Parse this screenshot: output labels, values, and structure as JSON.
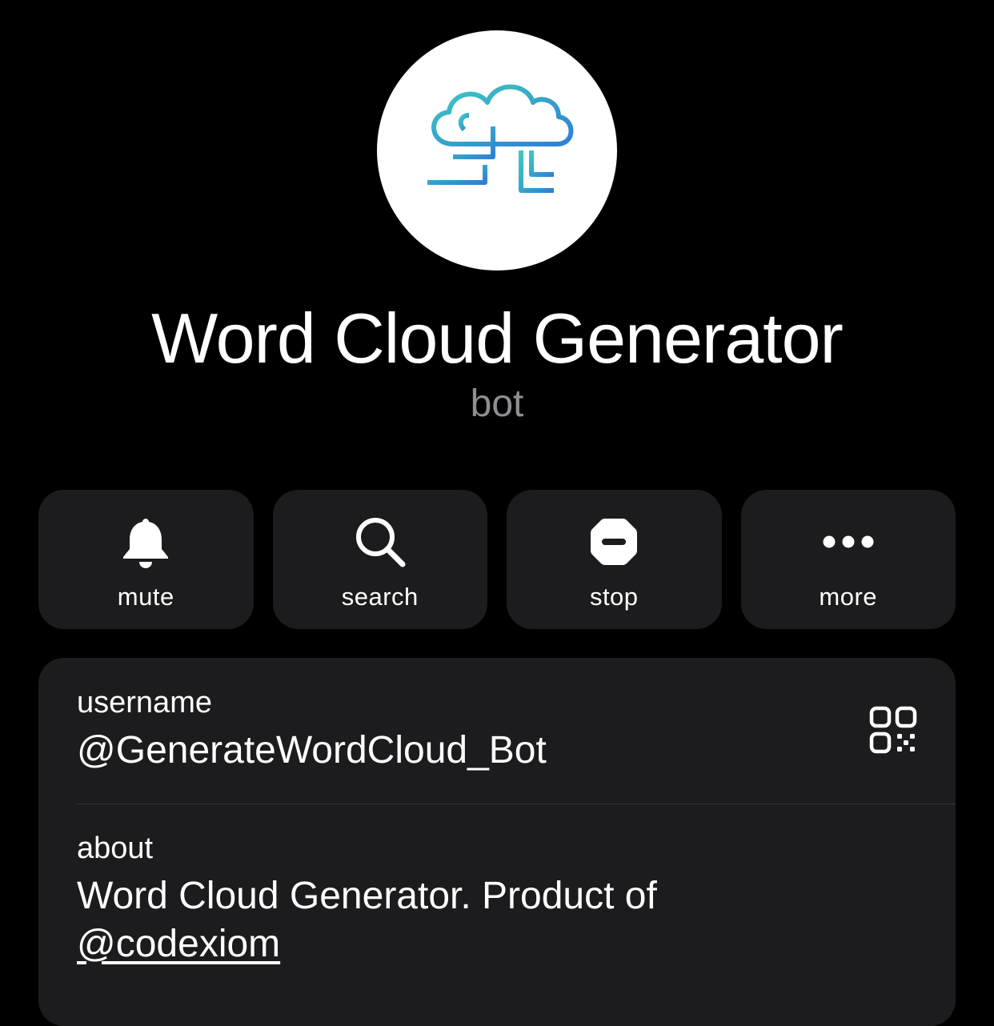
{
  "profile": {
    "name": "Word Cloud Generator",
    "type": "bot",
    "avatar_icon": "cloud-circuit-logo-icon"
  },
  "actions": [
    {
      "label": "mute",
      "icon": "bell-icon"
    },
    {
      "label": "search",
      "icon": "magnifier-icon"
    },
    {
      "label": "stop",
      "icon": "stop-sign-icon"
    },
    {
      "label": "more",
      "icon": "ellipsis-icon"
    }
  ],
  "info": {
    "username_label": "username",
    "username_value": "@GenerateWordCloud_Bot",
    "qr_icon": "qr-code-icon",
    "about_label": "about",
    "about_text": "Word Cloud Generator. Product of",
    "about_link": "@codexiom"
  },
  "colors": {
    "background": "#000000",
    "card": "#1c1c1e",
    "secondary_text": "#8e8e93",
    "logo_blue": "#2f8fd6",
    "logo_teal": "#3ec9c0"
  }
}
